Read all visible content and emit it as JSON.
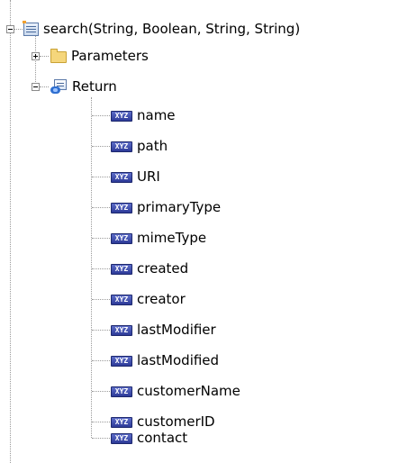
{
  "tree": {
    "method": {
      "label": "search(String, Boolean, String, String)",
      "icon": "method-icon",
      "expanded": true
    },
    "parameters": {
      "label": "Parameters",
      "icon": "folder-icon",
      "expanded": false
    },
    "return": {
      "label": "Return",
      "icon": "return-icon",
      "expanded": true
    },
    "type_badge_text": "XYZ",
    "fields": [
      {
        "label": "name"
      },
      {
        "label": "path"
      },
      {
        "label": "URI"
      },
      {
        "label": "primaryType"
      },
      {
        "label": "mimeType"
      },
      {
        "label": "created"
      },
      {
        "label": "creator"
      },
      {
        "label": "lastModifier"
      },
      {
        "label": "lastModified"
      },
      {
        "label": "customerName"
      },
      {
        "label": "customerID"
      },
      {
        "label": "contact"
      }
    ]
  },
  "colors": {
    "connector": "#9a9a9a",
    "type_badge": "#2d3a98",
    "folder": "#f5d67b"
  }
}
